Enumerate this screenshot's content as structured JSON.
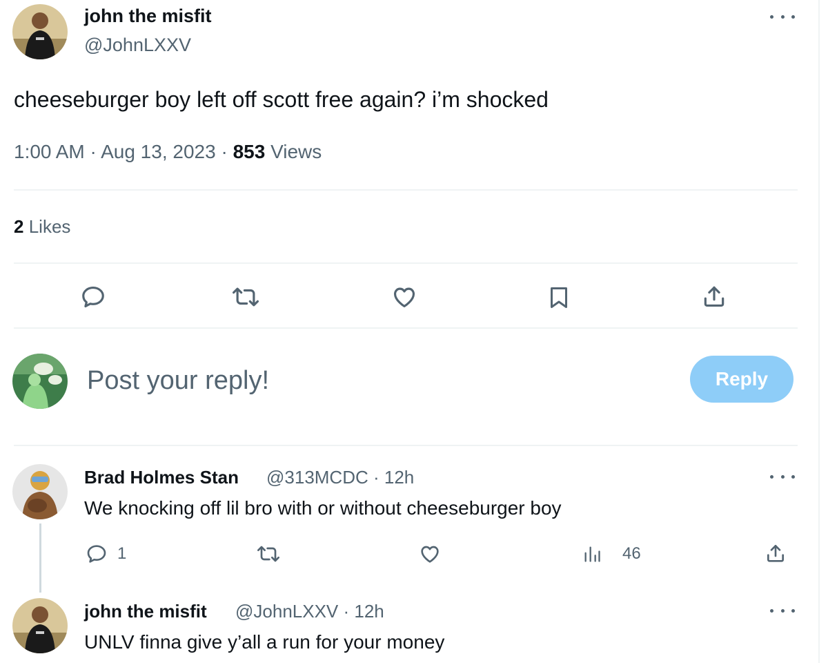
{
  "main_tweet": {
    "author_name": "john the misfit",
    "author_handle": "@JohnLXXV",
    "text": "cheeseburger boy left off scott free again? i’m shocked",
    "time": "1:00 AM",
    "date": "Aug 13, 2023",
    "views_count": "853",
    "views_label": "Views",
    "likes_count": "2",
    "likes_label": "Likes"
  },
  "actions": {
    "icons": [
      "reply-icon",
      "retweet-icon",
      "like-icon",
      "bookmark-icon",
      "share-icon"
    ]
  },
  "composer": {
    "placeholder": "Post your reply!",
    "button_label": "Reply"
  },
  "replies": [
    {
      "author_name": "Brad Holmes Stan",
      "author_handle": "@313MCDC",
      "age": "12h",
      "text": "We knocking off lil bro with or without cheeseburger boy",
      "reply_count": "1",
      "views_count": "46"
    },
    {
      "author_name": "john the misfit",
      "author_handle": "@JohnLXXV",
      "age": "12h",
      "text": "UNLV finna give y’all a run for your money"
    }
  ],
  "colors": {
    "text_primary": "#0f1419",
    "text_secondary": "#536471",
    "divider": "#eff3f4",
    "reply_button_bg": "#8ecdf8"
  }
}
